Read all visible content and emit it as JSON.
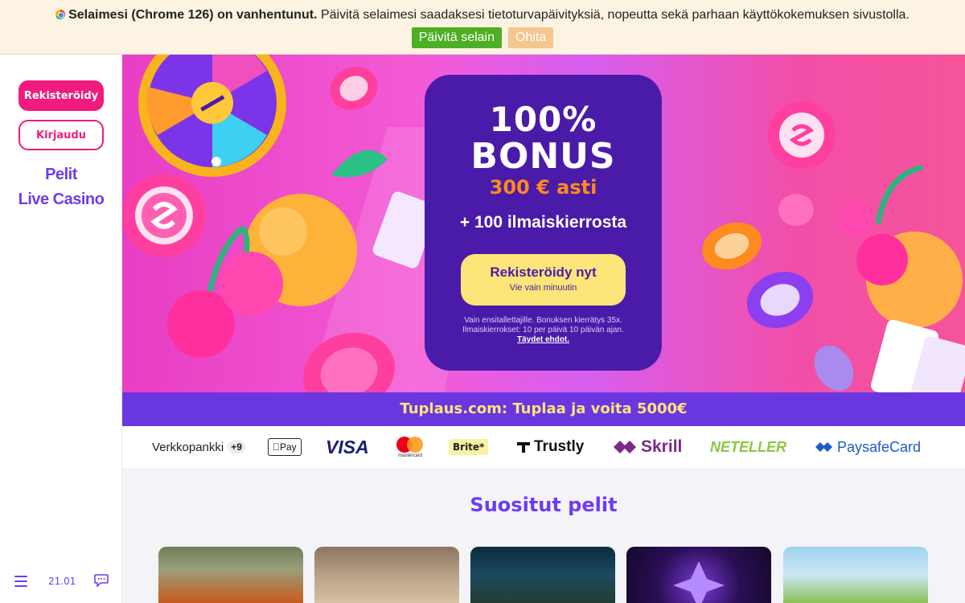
{
  "browser_warning": {
    "bold": "Selaimesi (Chrome 126) on vanhentunut.",
    "text": " Päivitä selaimesi saadaksesi tietoturvapäivityksiä, nopeutta sekä parhaan käyttökokemuksen sivustolla.",
    "update_label": "Päivitä selain",
    "skip_label": "Ohita"
  },
  "sidebar": {
    "register_label": "Rekisteröidy",
    "login_label": "Kirjaudu",
    "nav": [
      "Pelit",
      "Live Casino"
    ],
    "time": "21.01"
  },
  "hero": {
    "percent": "100%",
    "bonus_word": "BONUS",
    "amount": "300 € asti",
    "spins": "+ 100 ilmaiskierrosta",
    "cta_title": "Rekisteröidy nyt",
    "cta_subtitle": "Vie vain minuutin",
    "terms": "Vain ensitallettajille. Bonuksen kierrätys 35x. Ilmaiskierrokset: 10 per päivä 10 päivän ajan.",
    "terms_link": "Täydet ehdot."
  },
  "promo": {
    "text": "Tuplaus.com: Tuplaa ja voita 5000€"
  },
  "payments": {
    "bank": "Verkkopankki",
    "bank_extra": "+9",
    "apple": "Pay",
    "visa": "VISA",
    "mastercard": "mastercard",
    "brite": "Brite*",
    "trustly": "Trustly",
    "skrill": "Skrill",
    "neteller": "NETELLER",
    "paysafe": "PaysafeCard"
  },
  "games_section": {
    "title": "Suositut pelit"
  },
  "colors": {
    "brand_pink": "#f01b7d",
    "brand_purple": "#6b3df0",
    "card_purple": "#4a1ba8",
    "cta_yellow": "#fde57a",
    "amount_orange": "#ff8a1f"
  }
}
